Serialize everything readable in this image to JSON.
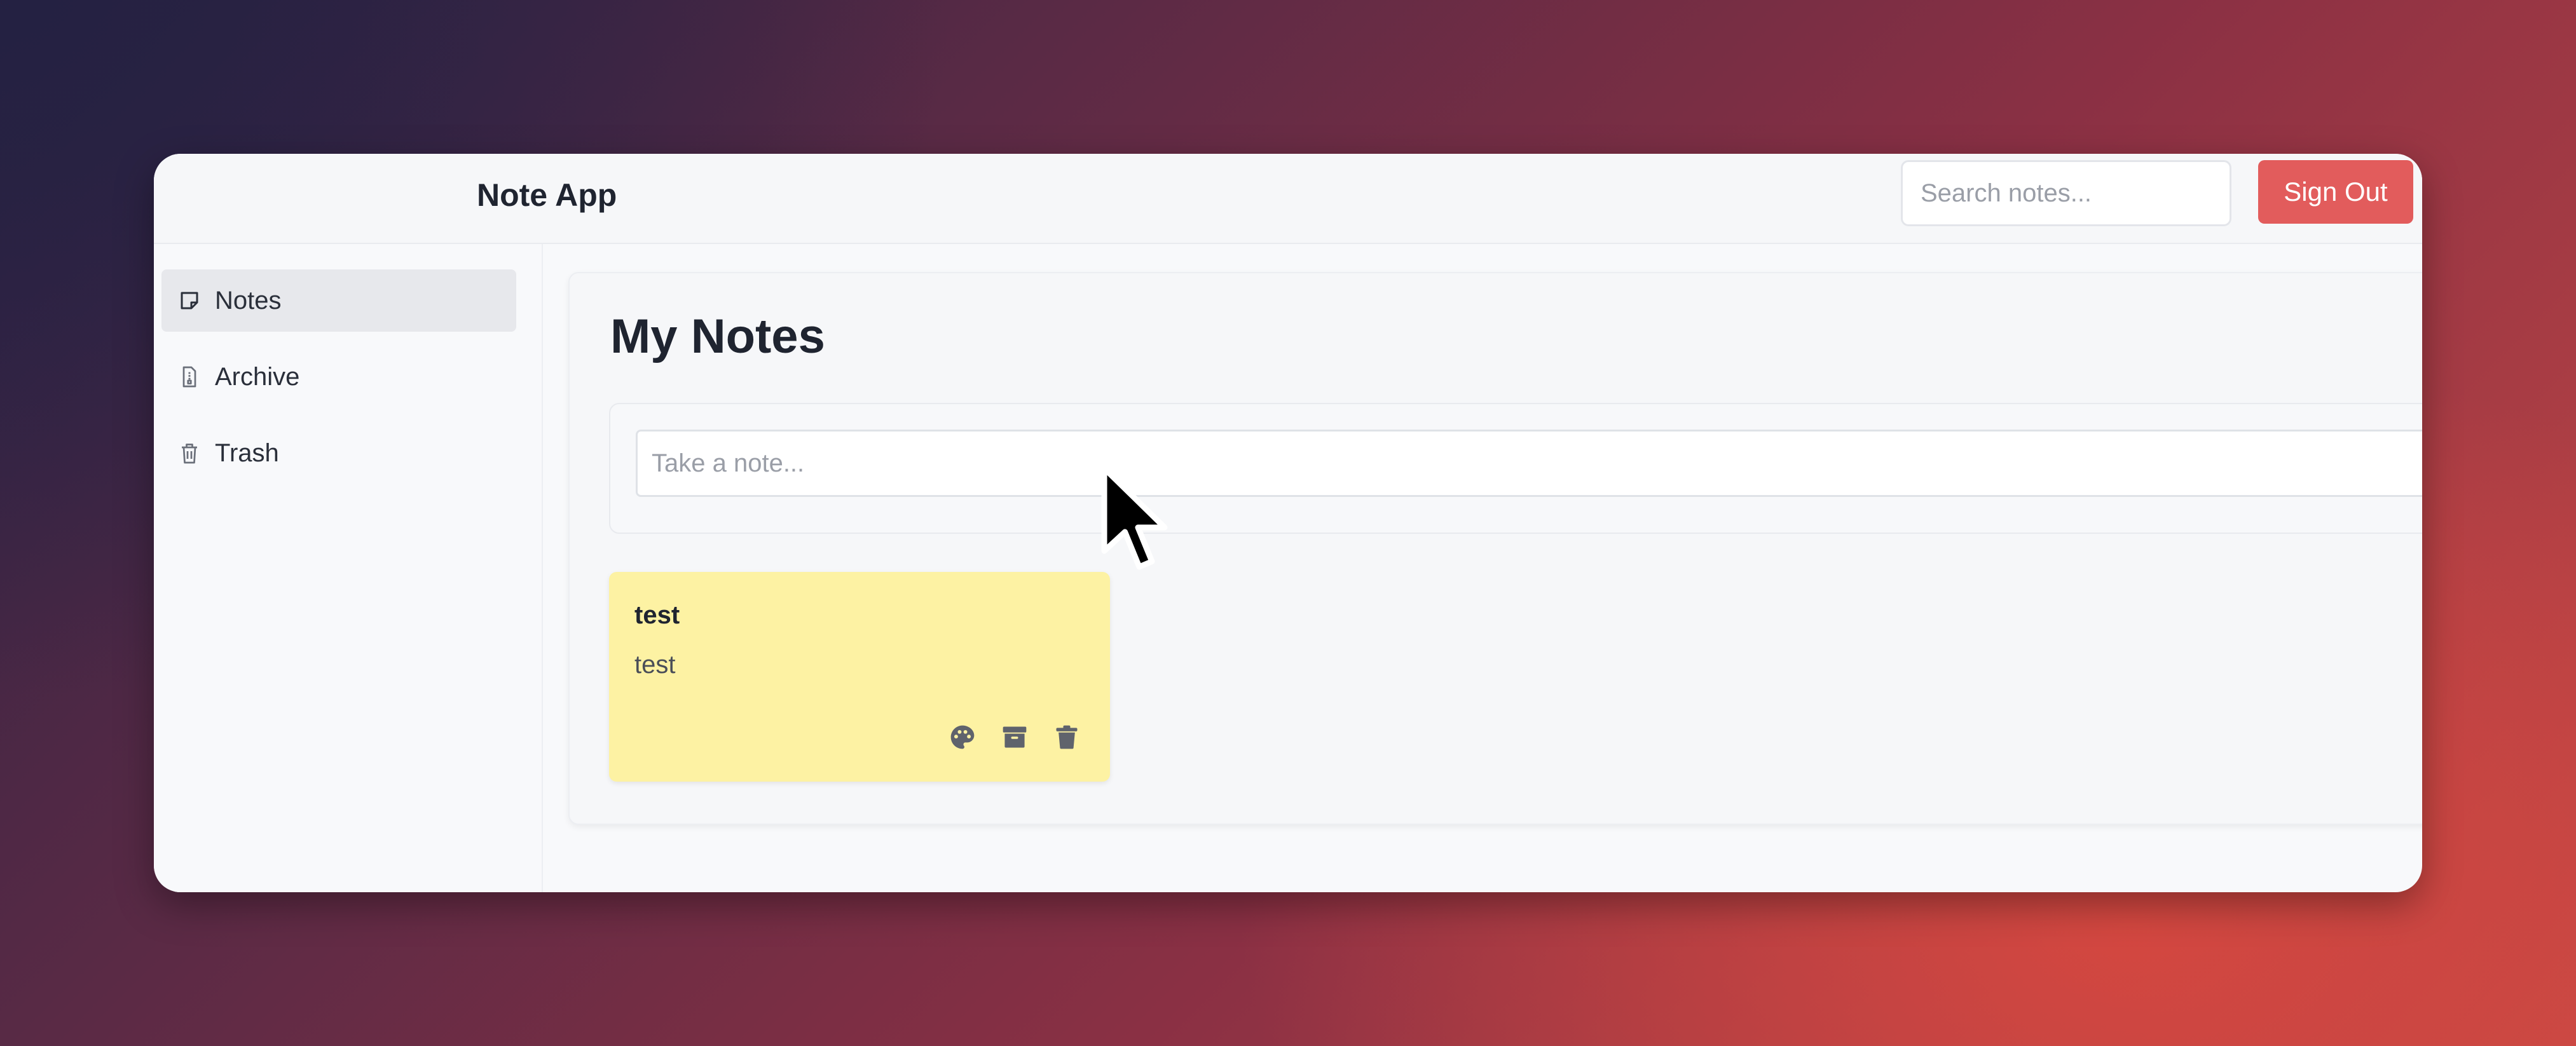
{
  "header": {
    "app_title": "Note App",
    "search_placeholder": "Search notes...",
    "sign_out_label": "Sign Out"
  },
  "sidebar": {
    "items": [
      {
        "label": "Notes",
        "icon": "sticky-note-icon",
        "active": true
      },
      {
        "label": "Archive",
        "icon": "archive-file-icon",
        "active": false
      },
      {
        "label": "Trash",
        "icon": "trash-icon",
        "active": false
      }
    ]
  },
  "main": {
    "title": "My Notes",
    "composer_placeholder": "Take a note...",
    "notes": [
      {
        "title": "test",
        "body": "test",
        "color": "#fdf2a3",
        "actions": [
          "palette-icon",
          "archive-icon",
          "trash-icon"
        ]
      }
    ]
  },
  "colors": {
    "accent": "#e25c5c",
    "note_yellow": "#fdf2a3"
  }
}
